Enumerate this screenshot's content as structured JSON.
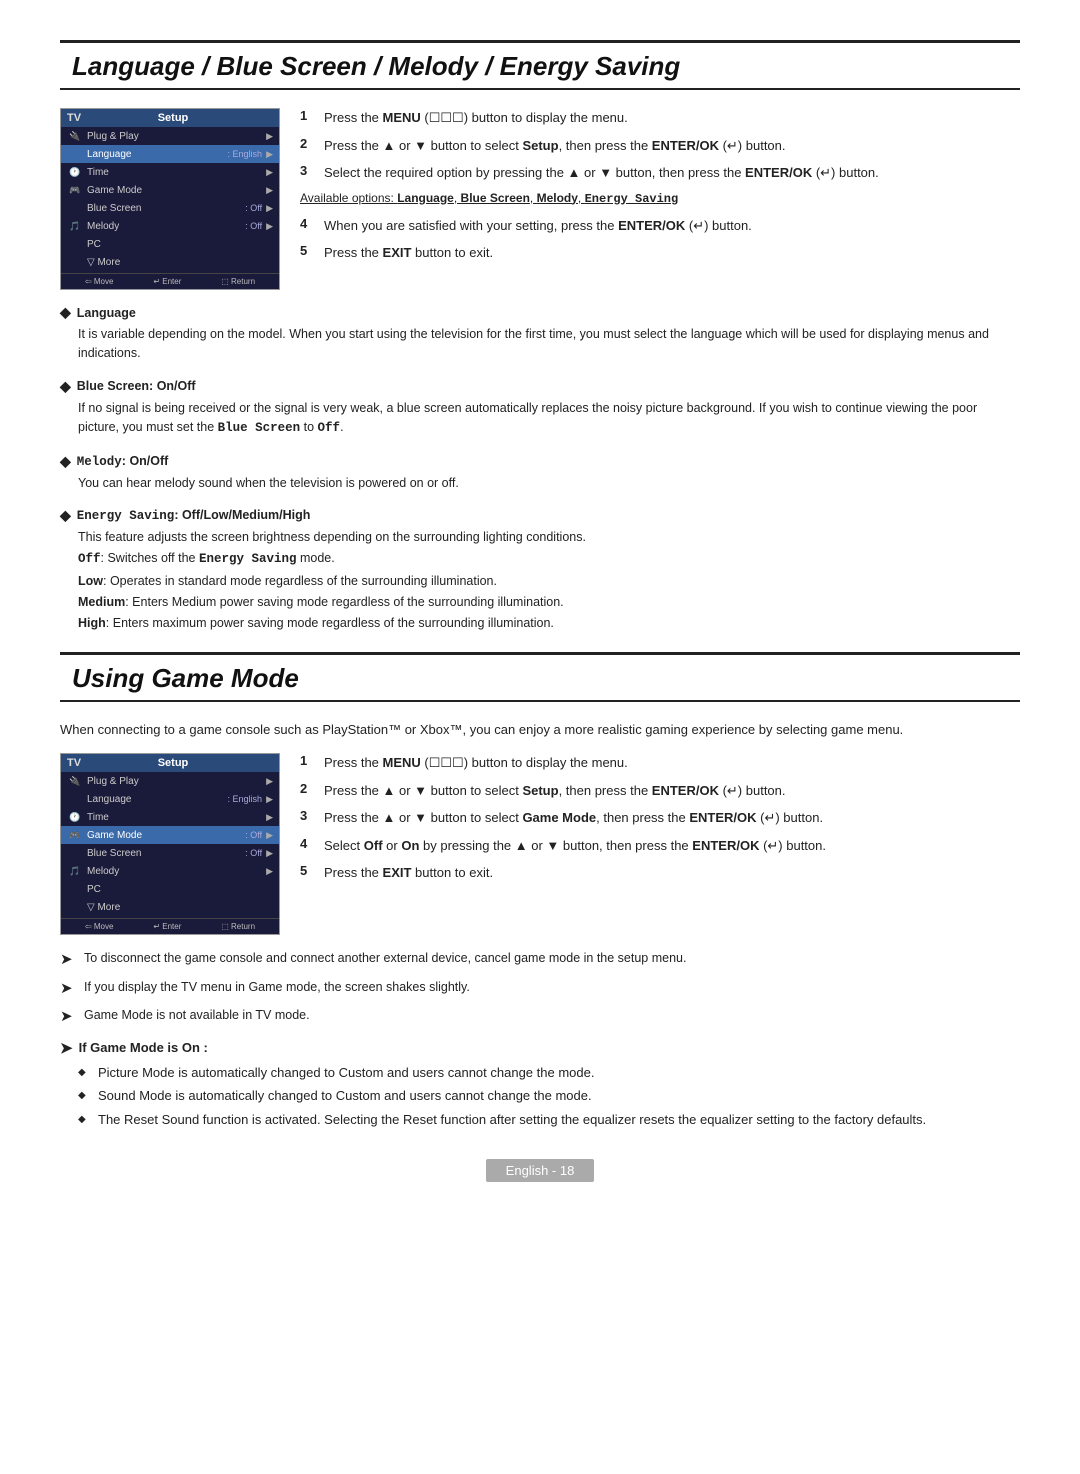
{
  "section1": {
    "title": "Language / Blue Screen / Melody / Energy Saving",
    "steps": [
      {
        "num": "1",
        "text": "Press the <b>MENU</b> (&#x2610;&#x2610;&#x2610;) button to display the menu."
      },
      {
        "num": "2",
        "text": "Press the ▲ or ▼ button to select <b>Setup</b>, then press the <b>ENTER/OK</b> (&#x21B5;) button."
      },
      {
        "num": "3",
        "text": "Select the required option by pressing the ▲ or ▼ button, then press the <b>ENTER/OK</b> (&#x21B5;) button."
      }
    ],
    "available_options_label": "Available options:",
    "available_options": "Language, Blue Screen, Melody, Energy Saving",
    "steps_cont": [
      {
        "num": "4",
        "text": "When you are satisfied with your setting, press the <b>ENTER/OK</b> (&#x21B5;) button."
      },
      {
        "num": "5",
        "text": "Press the <b>EXIT</b> button to exit."
      }
    ],
    "bullets": [
      {
        "title": "Language",
        "body": "It is variable depending on the model. When you start using the television for the first time, you must select the language which will be used for displaying menus and indications."
      },
      {
        "title": "Blue Screen: On/Off",
        "body": "If no signal is being received or the signal is very weak, a blue screen automatically replaces the noisy picture background. If you wish to continue viewing the poor picture, you must set the <b>Blue Screen</b> to <b>Off</b>."
      },
      {
        "title": "Melody: On/Off",
        "body": "You can hear melody sound when the television is powered on or off."
      },
      {
        "title": "Energy Saving: Off/Low/Medium/High",
        "body_lines": [
          "This feature adjusts the screen brightness depending on the surrounding lighting conditions.",
          "<b class='mono'>Off</b>: Switches off the <b>Energy Saving</b> mode.",
          "<b>Low</b>: Operates in standard mode regardless of the surrounding illumination.",
          "<b>Medium</b>: Enters Medium power saving mode regardless of the surrounding illumination.",
          "<b>High</b>: Enters maximum power saving mode regardless of the surrounding illumination."
        ]
      }
    ],
    "menu": {
      "title_left": "TV",
      "title_right": "Setup",
      "rows": [
        {
          "icon": "🔌",
          "label": "Plug & Play",
          "value": "",
          "arrow": "▶",
          "highlighted": false
        },
        {
          "icon": "",
          "label": "Language",
          "value": ": English",
          "arrow": "▶",
          "highlighted": true
        },
        {
          "icon": "🕐",
          "label": "Time",
          "value": "",
          "arrow": "▶",
          "highlighted": false
        },
        {
          "icon": "🎮",
          "label": "Game Mode",
          "value": "",
          "arrow": "▶",
          "highlighted": false
        },
        {
          "icon": "",
          "label": "Blue Screen",
          "value": ": Off",
          "arrow": "▶",
          "highlighted": false
        },
        {
          "icon": "🎵",
          "label": "Melody",
          "value": ": Off",
          "arrow": "▶",
          "highlighted": false
        },
        {
          "icon": "",
          "label": "PC",
          "value": "",
          "arrow": "",
          "highlighted": false
        },
        {
          "icon": "",
          "label": "▽ More",
          "value": "",
          "arrow": "",
          "highlighted": false
        }
      ],
      "footer": [
        "⇦ Move",
        "↵ Enter",
        "⬚ Return"
      ]
    }
  },
  "section2": {
    "title": "Using Game Mode",
    "intro": "When connecting to a game console such as PlayStation™ or Xbox™, you can enjoy a more realistic gaming experience by selecting game menu.",
    "steps": [
      {
        "num": "1",
        "text": "Press the <b>MENU</b> (&#x2610;&#x2610;&#x2610;) button to display the menu."
      },
      {
        "num": "2",
        "text": "Press the ▲ or ▼ button to select <b>Setup</b>, then press the <b>ENTER/OK</b> (&#x21B5;) button."
      },
      {
        "num": "3",
        "text": "Press the ▲ or ▼ button to select <b>Game Mode</b>, then press the <b>ENTER/OK</b> (&#x21B5;) button."
      },
      {
        "num": "4",
        "text": "Select <b>Off</b> or <b>On</b> by pressing the ▲ or ▼ button, then press the <b>ENTER/OK</b> (&#x21B5;) button."
      },
      {
        "num": "5",
        "text": "Press the <b>EXIT</b> button to exit."
      }
    ],
    "menu": {
      "title_left": "TV",
      "title_right": "Setup",
      "rows": [
        {
          "icon": "🔌",
          "label": "Plug & Play",
          "value": "",
          "arrow": "▶",
          "highlighted": false
        },
        {
          "icon": "",
          "label": "Language",
          "value": ": English",
          "arrow": "▶",
          "highlighted": false
        },
        {
          "icon": "🕐",
          "label": "Time",
          "value": "",
          "arrow": "▶",
          "highlighted": false
        },
        {
          "icon": "🎮",
          "label": "Game Mode",
          "value": ": Off",
          "arrow": "▶",
          "highlighted": true
        },
        {
          "icon": "",
          "label": "Blue Screen",
          "value": ": Off",
          "arrow": "▶",
          "highlighted": false
        },
        {
          "icon": "🎵",
          "label": "Melody",
          "value": ": Off",
          "arrow": "▶",
          "highlighted": false
        },
        {
          "icon": "",
          "label": "PC",
          "value": "",
          "arrow": "",
          "highlighted": false
        },
        {
          "icon": "",
          "label": "▽ More",
          "value": "",
          "arrow": "",
          "highlighted": false
        }
      ],
      "footer": [
        "⇦ Move",
        "↵ Enter",
        "⬚ Return"
      ]
    },
    "notes": [
      "To disconnect the game console and connect another external device, cancel game mode in the setup menu.",
      "If you display the TV menu in Game mode, the screen shakes slightly.",
      "Game Mode is not available in TV mode."
    ],
    "if_game_mode": {
      "title": "If Game Mode is On :",
      "items": [
        "Picture Mode is automatically changed to Custom and users cannot change the mode.",
        "Sound Mode is automatically changed to Custom and users cannot change the mode.",
        "The Reset Sound function is activated. Selecting the Reset function after setting the equalizer resets the equalizer setting to the factory defaults."
      ]
    }
  },
  "footer": {
    "label": "English - 18"
  }
}
